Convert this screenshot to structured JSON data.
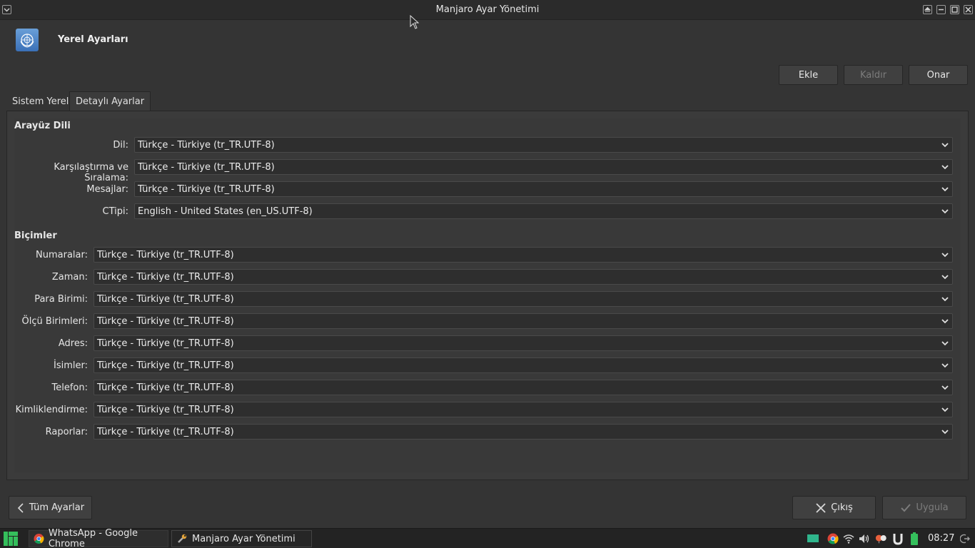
{
  "window": {
    "title": "Manjaro Ayar Yönetimi"
  },
  "header": {
    "title": "Yerel Ayarları"
  },
  "toolbar": {
    "add": "Ekle",
    "remove": "Kaldır",
    "repair": "Onar"
  },
  "tabs": [
    {
      "label": "Sistem Yereli",
      "active": false
    },
    {
      "label": "Detaylı Ayarlar",
      "active": true
    }
  ],
  "interface_language": {
    "title": "Arayüz Dili",
    "rows": [
      {
        "label": "Dil:",
        "value": "Türkçe - Türkiye (tr_TR.UTF-8)"
      },
      {
        "label": "Karşılaştırma ve Sıralama:",
        "value": "Türkçe - Türkiye (tr_TR.UTF-8)"
      },
      {
        "label": "Mesajlar:",
        "value": "Türkçe - Türkiye (tr_TR.UTF-8)"
      },
      {
        "label": "CTipi:",
        "value": "English - United States (en_US.UTF-8)"
      }
    ]
  },
  "formats": {
    "title": "Biçimler",
    "rows": [
      {
        "label": "Numaralar:",
        "value": "Türkçe - Türkiye (tr_TR.UTF-8)"
      },
      {
        "label": "Zaman:",
        "value": "Türkçe - Türkiye (tr_TR.UTF-8)"
      },
      {
        "label": "Para Birimi:",
        "value": "Türkçe - Türkiye (tr_TR.UTF-8)"
      },
      {
        "label": "Ölçü Birimleri:",
        "value": "Türkçe - Türkiye (tr_TR.UTF-8)"
      },
      {
        "label": "Adres:",
        "value": "Türkçe - Türkiye (tr_TR.UTF-8)"
      },
      {
        "label": "İsimler:",
        "value": "Türkçe - Türkiye (tr_TR.UTF-8)"
      },
      {
        "label": "Telefon:",
        "value": "Türkçe - Türkiye (tr_TR.UTF-8)"
      },
      {
        "label": "Kimliklendirme:",
        "value": "Türkçe - Türkiye (tr_TR.UTF-8)"
      },
      {
        "label": "Raporlar:",
        "value": "Türkçe - Türkiye (tr_TR.UTF-8)"
      }
    ]
  },
  "footer": {
    "all_settings": "Tüm Ayarlar",
    "quit": "Çıkış",
    "apply": "Uygula"
  },
  "taskbar": {
    "tasks": [
      {
        "label": "WhatsApp - Google Chrome",
        "icon": "chrome-icon"
      },
      {
        "label": "Manjaro Ayar Yönetimi",
        "icon": "wrench-icon"
      }
    ],
    "clock": "08:27"
  },
  "colors": {
    "manjaro_green": "#35bf5c",
    "accent_blue": "#4a86c8"
  }
}
